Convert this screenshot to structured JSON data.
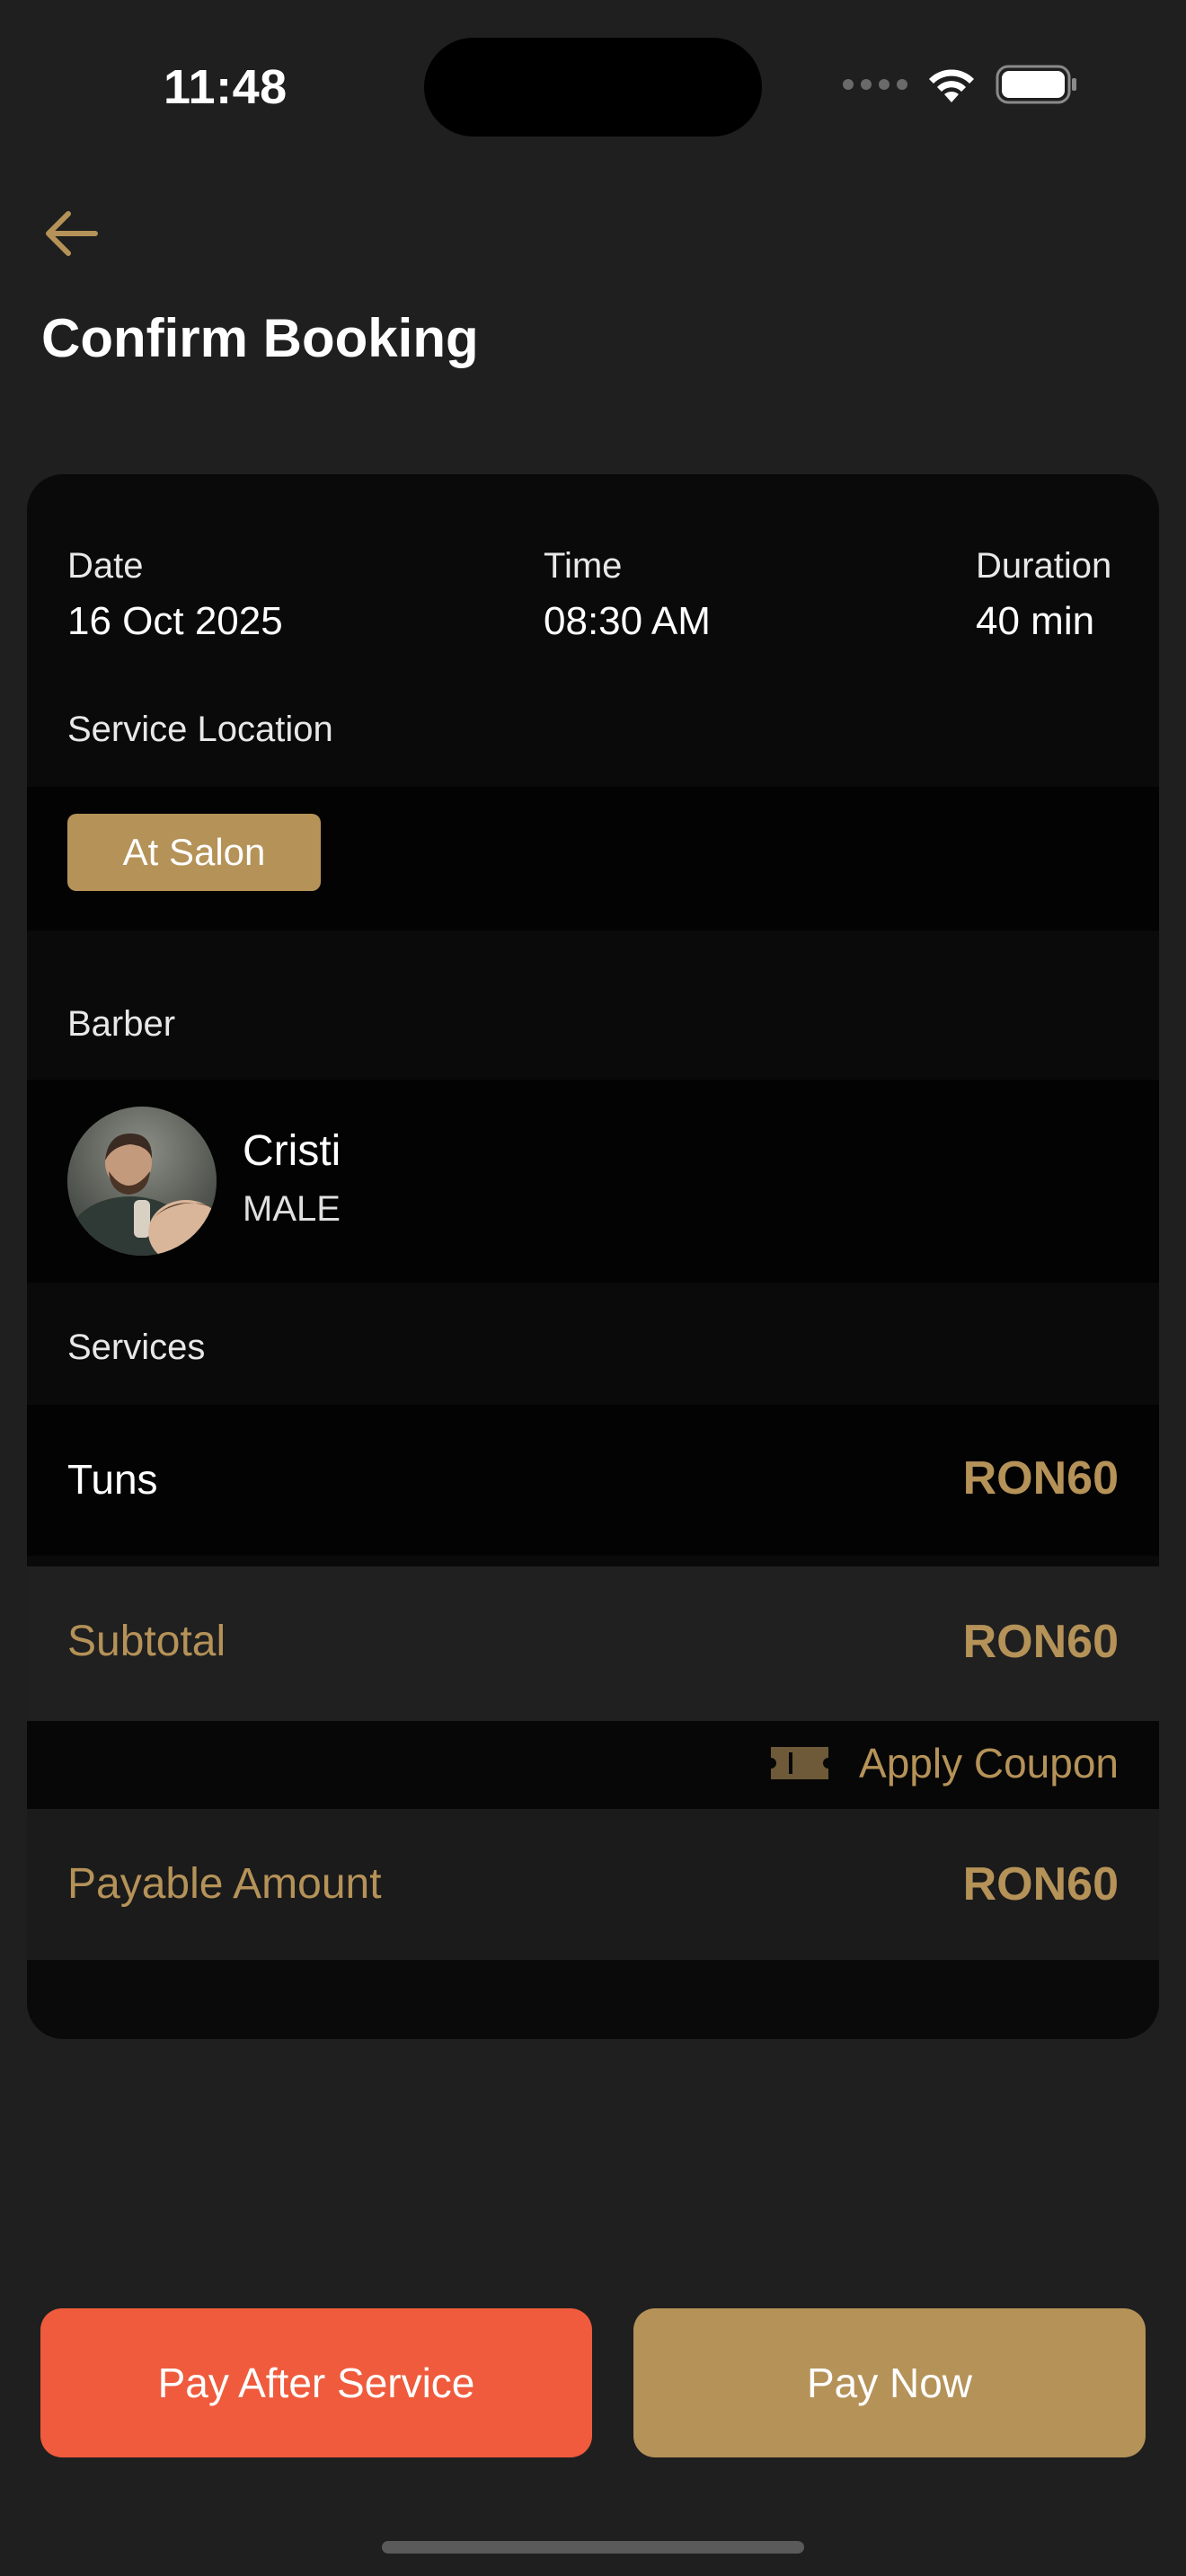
{
  "status_bar": {
    "time": "11:48"
  },
  "header": {
    "title": "Confirm Booking"
  },
  "booking": {
    "date_label": "Date",
    "date_value": "16 Oct 2025",
    "time_label": "Time",
    "time_value": "08:30 AM",
    "duration_label": "Duration",
    "duration_value": "40 min"
  },
  "location": {
    "label": "Service Location",
    "option": "At Salon"
  },
  "barber": {
    "label": "Barber",
    "name": "Cristi",
    "gender": "MALE"
  },
  "services": {
    "label": "Services",
    "items": [
      {
        "name": "Tuns",
        "price": "RON60"
      }
    ]
  },
  "summary": {
    "subtotal_label": "Subtotal",
    "subtotal_value": "RON60",
    "coupon_label": "Apply Coupon",
    "payable_label": "Payable Amount",
    "payable_value": "RON60"
  },
  "actions": {
    "pay_after_label": "Pay After Service",
    "pay_now_label": "Pay Now"
  },
  "colors": {
    "background": "#1f1f1f",
    "card": "#0a0a0a",
    "accent_gold": "#b59258",
    "accent_orange": "#ef5b3c"
  },
  "icons": [
    "back-arrow-icon",
    "wifi-icon",
    "battery-icon",
    "signal-icon",
    "coupon-ticket-icon"
  ]
}
